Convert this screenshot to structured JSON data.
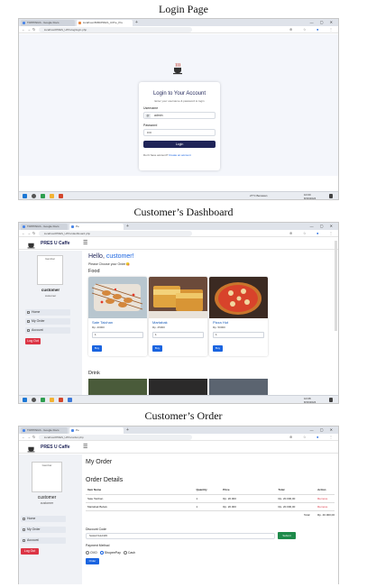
{
  "captions": {
    "login": "Login Page",
    "dashboard": "Customer’s Dashboard",
    "order": "Customer’s Order"
  },
  "browser": {
    "tab_inactive": "TOPPINGS - Google Docs",
    "tab_login": "localhost:8080/PRES_U/Pre_Pre",
    "tab_app": "Pe",
    "url_login": "localhost/PRES_U/Prelog/login.php",
    "url_dashboard": "localhost/PRES_U/Pre/dashboard.php",
    "url_order": "localhost/PRES_U/Pre/order.php",
    "window_controls": "—  ▢  ✕"
  },
  "taskbar": {
    "weather": "27°C Berawan",
    "time_1": "10:00",
    "date_1": "8/16/2024",
    "time_2": "10:08",
    "date_2": "8/16/2024"
  },
  "login": {
    "title": "Login to Your Account",
    "subtitle": "Enter your username & password to login",
    "username_label": "Username",
    "username_value": "admin",
    "password_label": "Password",
    "password_value": "••••",
    "login_button": "Login",
    "footer_text": "Don't have account?",
    "create_link": "Create an account"
  },
  "app": {
    "brand": "PRES U Caffe",
    "menu_icon": "hamburger-icon",
    "avatar_alt": "Gambar",
    "user_name": "customer",
    "user_role": "customer",
    "side_items": [
      "Home",
      "My Order",
      "Account"
    ],
    "logout": "Log Out"
  },
  "dashboard": {
    "greeting": "Hello, ",
    "greeting_user": "customer!",
    "prompt": "Please Choose your Order😋",
    "food_heading": "Food",
    "drink_heading": "Drink",
    "products": [
      {
        "name": "Sate Taichan",
        "price": "Rp. 20000",
        "qty": "1",
        "buy": "Buy"
      },
      {
        "name": "Martabak",
        "price": "Rp. 25000",
        "qty": "1",
        "buy": "Buy"
      },
      {
        "name": "Pizza Hut",
        "price": "Rp. 50000",
        "qty": "1",
        "buy": "Buy"
      }
    ]
  },
  "order": {
    "title": "My Order",
    "details": "Order Details",
    "headers": [
      "Item Name",
      "Quantity",
      "Price",
      "Total",
      "Action"
    ],
    "rows": [
      {
        "name": "Sate Taichan",
        "qty": "1",
        "price": "Rp. 20.000",
        "total": "Rp. 20.000,00",
        "action": "Remove"
      },
      {
        "name": "Martabak Bebek",
        "qty": "1",
        "price": "Rp. 20.000",
        "total": "Rp. 20.000,00",
        "action": "Remove"
      }
    ],
    "total_label": "Total:",
    "total_value": "Rp. 40.000,00",
    "discount_label": "Discount Code",
    "discount_value": "SAHAYA12345",
    "submit": "Submit",
    "payment_label": "Payment Method",
    "payment_options": [
      "OVO",
      "ShopeePay",
      "Cash"
    ],
    "order_button": "Order"
  },
  "colors": {
    "navy": "#1f2458",
    "link_blue": "#1a64e0",
    "danger": "#dc3545",
    "success": "#1e8a4a"
  }
}
